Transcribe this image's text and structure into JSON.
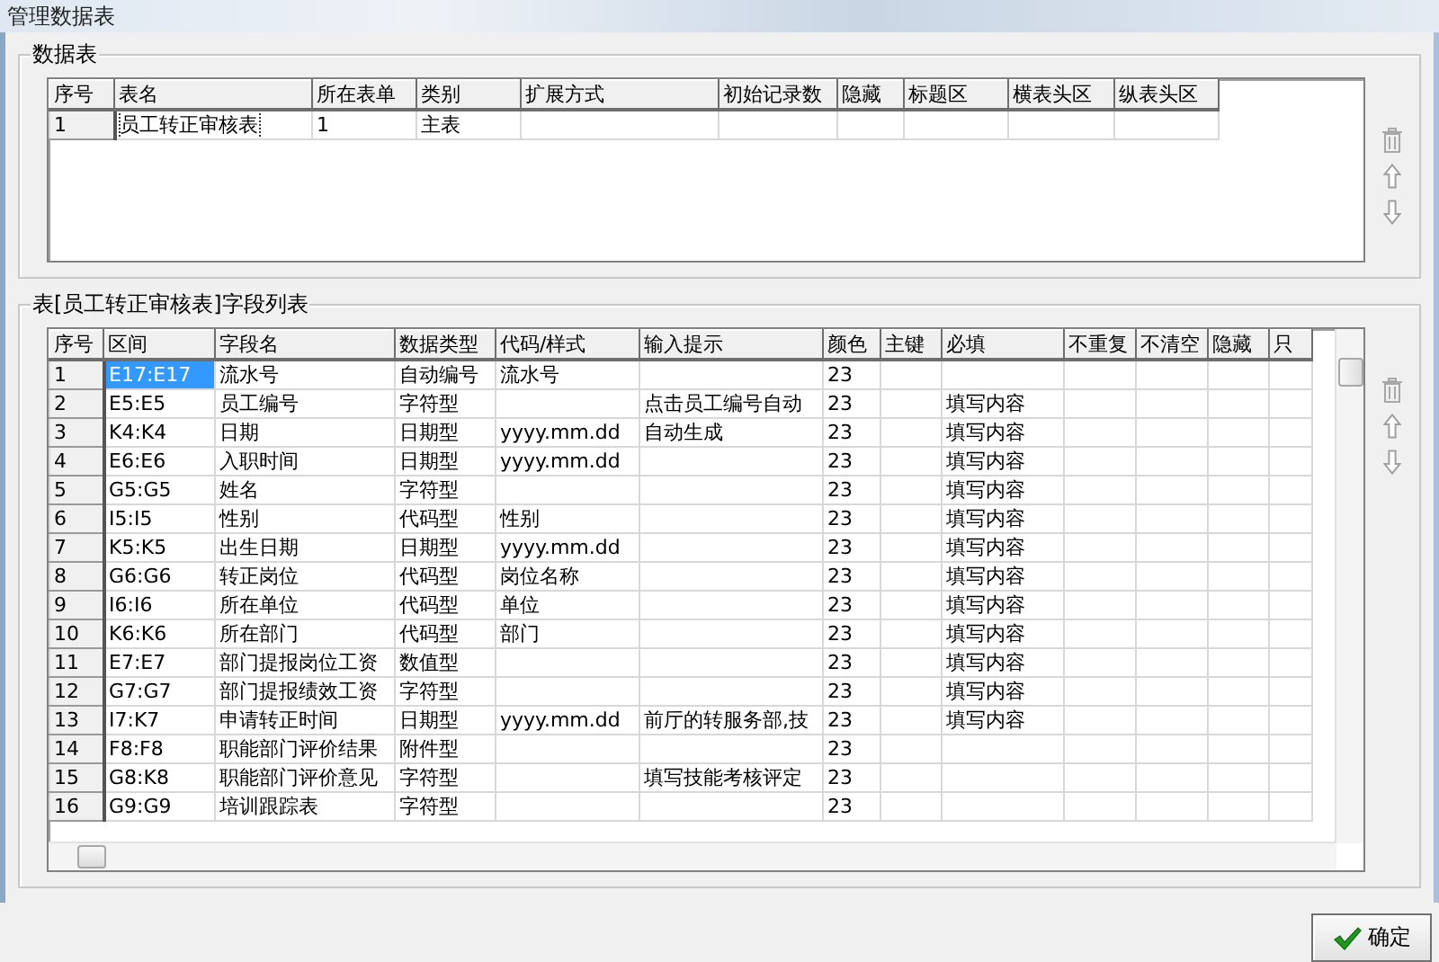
{
  "window": {
    "title": "管理数据表"
  },
  "tables_group": {
    "title": "数据表",
    "columns": [
      "序号",
      "表名",
      "所在表单",
      "类别",
      "扩展方式",
      "初始记录数",
      "隐藏",
      "标题区",
      "横表头区",
      "纵表头区"
    ],
    "rows": [
      {
        "cells": [
          "1",
          "员工转正审核表",
          "1",
          "主表",
          "",
          "",
          "",
          "",
          "",
          ""
        ],
        "selected": true
      }
    ]
  },
  "fields_group": {
    "title": "表[员工转正审核表]字段列表",
    "columns": [
      "序号",
      "区间",
      "字段名",
      "数据类型",
      "代码/样式",
      "输入提示",
      "颜色",
      "主键",
      "必填",
      "不重复",
      "不清空",
      "隐藏",
      "只"
    ],
    "rows": [
      {
        "cells": [
          "1",
          "E17:E17",
          "流水号",
          "自动编号",
          "流水号",
          "",
          "23",
          "",
          "",
          "",
          "",
          "",
          ""
        ],
        "selected": true
      },
      {
        "cells": [
          "2",
          "E5:E5",
          "员工编号",
          "字符型",
          "",
          "点击员工编号自动",
          "23",
          "",
          "填写内容",
          "",
          "",
          "",
          ""
        ],
        "selected": false
      },
      {
        "cells": [
          "3",
          "K4:K4",
          "日期",
          "日期型",
          "yyyy.mm.dd",
          "自动生成",
          "23",
          "",
          "填写内容",
          "",
          "",
          "",
          ""
        ],
        "selected": false
      },
      {
        "cells": [
          "4",
          "E6:E6",
          "入职时间",
          "日期型",
          "yyyy.mm.dd",
          "",
          "23",
          "",
          "填写内容",
          "",
          "",
          "",
          ""
        ],
        "selected": false
      },
      {
        "cells": [
          "5",
          "G5:G5",
          "姓名",
          "字符型",
          "",
          "",
          "23",
          "",
          "填写内容",
          "",
          "",
          "",
          ""
        ],
        "selected": false
      },
      {
        "cells": [
          "6",
          "I5:I5",
          "性别",
          "代码型",
          "性别",
          "",
          "23",
          "",
          "填写内容",
          "",
          "",
          "",
          ""
        ],
        "selected": false
      },
      {
        "cells": [
          "7",
          "K5:K5",
          "出生日期",
          "日期型",
          "yyyy.mm.dd",
          "",
          "23",
          "",
          "填写内容",
          "",
          "",
          "",
          ""
        ],
        "selected": false
      },
      {
        "cells": [
          "8",
          "G6:G6",
          "转正岗位",
          "代码型",
          "岗位名称",
          "",
          "23",
          "",
          "填写内容",
          "",
          "",
          "",
          ""
        ],
        "selected": false
      },
      {
        "cells": [
          "9",
          "I6:I6",
          "所在单位",
          "代码型",
          "单位",
          "",
          "23",
          "",
          "填写内容",
          "",
          "",
          "",
          ""
        ],
        "selected": false
      },
      {
        "cells": [
          "10",
          "K6:K6",
          "所在部门",
          "代码型",
          "部门",
          "",
          "23",
          "",
          "填写内容",
          "",
          "",
          "",
          ""
        ],
        "selected": false
      },
      {
        "cells": [
          "11",
          "E7:E7",
          "部门提报岗位工资",
          "数值型",
          "",
          "",
          "23",
          "",
          "填写内容",
          "",
          "",
          "",
          ""
        ],
        "selected": false
      },
      {
        "cells": [
          "12",
          "G7:G7",
          "部门提报绩效工资",
          "字符型",
          "",
          "",
          "23",
          "",
          "填写内容",
          "",
          "",
          "",
          ""
        ],
        "selected": false
      },
      {
        "cells": [
          "13",
          "I7:K7",
          "申请转正时间",
          "日期型",
          "yyyy.mm.dd",
          "前厅的转服务部,技",
          "23",
          "",
          "填写内容",
          "",
          "",
          "",
          ""
        ],
        "selected": false
      },
      {
        "cells": [
          "14",
          "F8:F8",
          "职能部门评价结果",
          "附件型",
          "",
          "",
          "23",
          "",
          "",
          "",
          "",
          "",
          ""
        ],
        "selected": false
      },
      {
        "cells": [
          "15",
          "G8:K8",
          "职能部门评价意见",
          "字符型",
          "",
          "填写技能考核评定",
          "23",
          "",
          "",
          "",
          "",
          "",
          ""
        ],
        "selected": false
      },
      {
        "cells": [
          "16",
          "G9:G9",
          "培训跟踪表",
          "字符型",
          "",
          "",
          "23",
          "",
          "",
          "",
          "",
          "",
          ""
        ],
        "selected": false
      }
    ]
  },
  "ok_button": {
    "label": "确定"
  }
}
